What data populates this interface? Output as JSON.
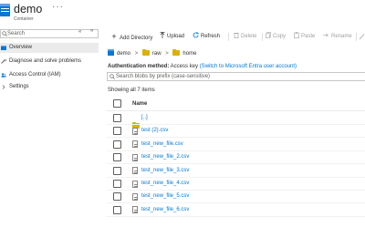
{
  "header": {
    "title": "demo",
    "more": "···",
    "subtitle": "Container"
  },
  "sidebar": {
    "search_placeholder": "Search",
    "items": [
      {
        "label": "Overview",
        "icon": "overview-icon",
        "active": true
      },
      {
        "label": "Diagnose and solve problems",
        "icon": "wrench-icon",
        "active": false
      },
      {
        "label": "Access Control (IAM)",
        "icon": "people-icon",
        "active": false
      },
      {
        "label": "Settings",
        "icon": "chevron-right-icon",
        "active": false
      }
    ]
  },
  "toolbar": {
    "add_directory": "Add Directory",
    "upload": "Upload",
    "refresh": "Refresh",
    "delete": "Delete",
    "copy": "Copy",
    "paste": "Paste",
    "rename": "Rename"
  },
  "breadcrumb": [
    "demo",
    "raw",
    "home"
  ],
  "auth": {
    "label": "Authentication method:",
    "value": "Access key",
    "link": "(Switch to Microsoft Entra user account)"
  },
  "filter": {
    "placeholder": "Search blobs by prefix (case-sensitive)"
  },
  "list": {
    "showing": "Showing all 7 items",
    "column_name": "Name",
    "rows": [
      {
        "name": "[..]",
        "type": "folder"
      },
      {
        "name": "test (2).csv",
        "type": "file"
      },
      {
        "name": "test_new_file.csv",
        "type": "file"
      },
      {
        "name": "test_new_file_2.csv",
        "type": "file"
      },
      {
        "name": "test_new_file_3.csv",
        "type": "file"
      },
      {
        "name": "test_new_file_4.csv",
        "type": "file"
      },
      {
        "name": "test_new_file_5.csv",
        "type": "file"
      },
      {
        "name": "test_new_file_6.csv",
        "type": "file"
      }
    ]
  },
  "colors": {
    "accent": "#0078d4",
    "folder": "#dcb000",
    "active_nav": "#ebebeb"
  }
}
